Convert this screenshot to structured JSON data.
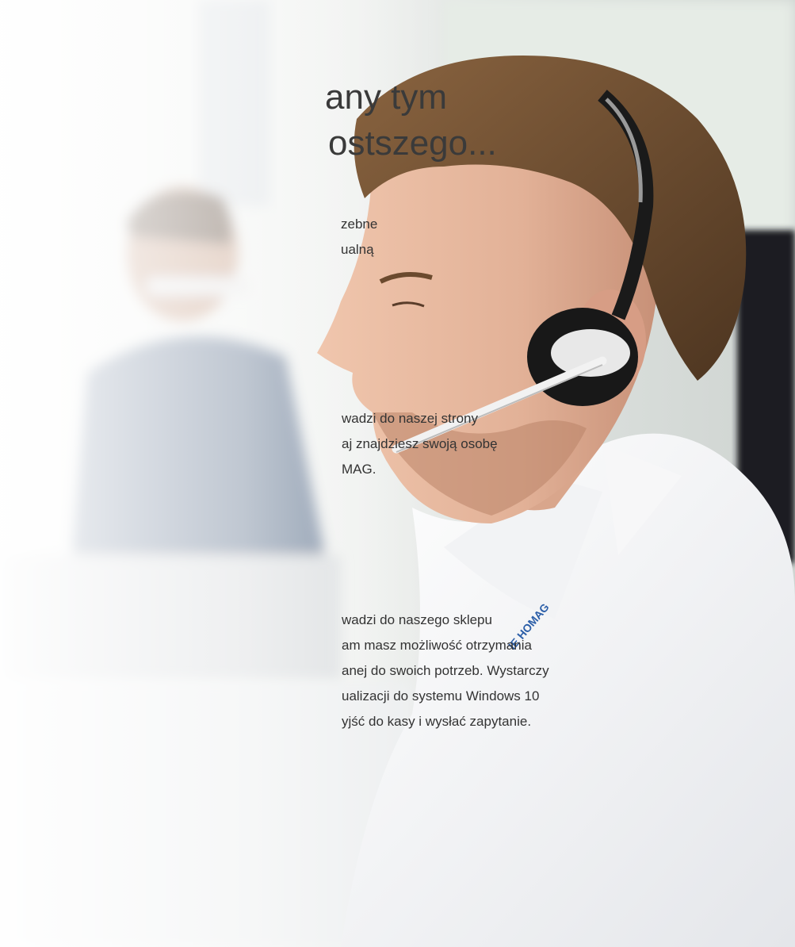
{
  "heading": {
    "line1": "any tym",
    "line2": "ostszego..."
  },
  "paragraphs": {
    "p1": [
      "zebne",
      "ualną"
    ],
    "p2": [
      "wadzi do naszej strony",
      "aj znajdziesz swoją osobę",
      "MAG."
    ],
    "p3": [
      "wadzi do naszego sklepu",
      "am masz możliwość otrzymania",
      "anej do swoich potrzeb. Wystarczy",
      "ualizacji do systemu Windows 10",
      "yjść do kasy i wysłać zapytanie."
    ]
  },
  "collar_logo": "HOMAG",
  "colors": {
    "background": "#f3f4f2",
    "shirt": "#ffffff",
    "hair": "#6b4a2e",
    "skin": "#e3b59b",
    "headset": "#1a1a1a",
    "text": "#2b2b2b",
    "logo": "#2c5fa8"
  }
}
